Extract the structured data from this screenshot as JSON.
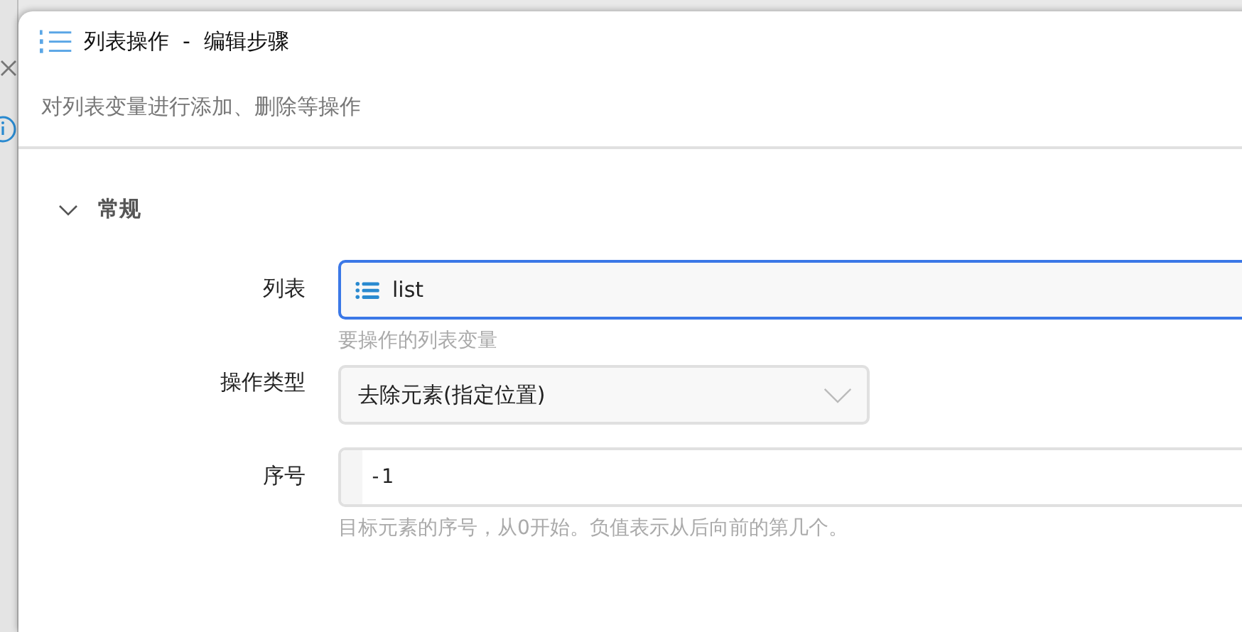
{
  "dialog": {
    "title": "列表操作  -  编辑步骤",
    "description": "对列表变量进行添加、删除等操作"
  },
  "section": {
    "title": "常规",
    "expanded": true
  },
  "fields": [
    {
      "kind": "variable",
      "label": "列表",
      "value": "list",
      "focused": true,
      "hint": "要操作的列表变量"
    },
    {
      "kind": "select",
      "label": "操作类型",
      "value": "去除元素(指定位置)",
      "focused": false
    },
    {
      "kind": "code",
      "label": "序号",
      "value": "-1",
      "focused": false,
      "hint": "目标元素的序号，从0开始。负值表示从后向前的第几个。"
    }
  ]
}
